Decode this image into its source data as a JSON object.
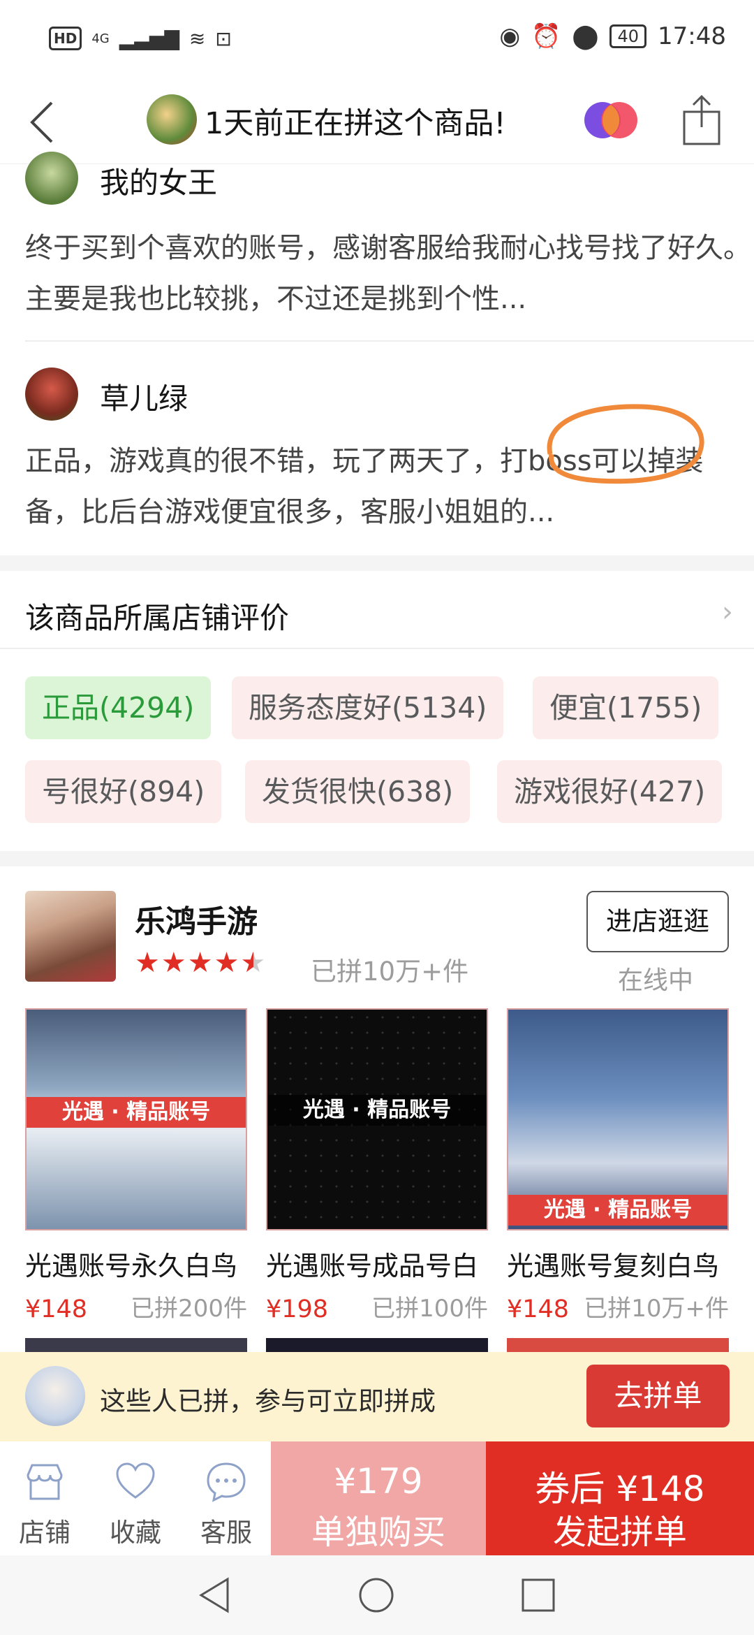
{
  "status_bar": {
    "network": "4G",
    "time": "17:48",
    "battery": "40"
  },
  "header": {
    "title": "1天前正在拼这个商品!"
  },
  "reviews": [
    {
      "name": "我的女王",
      "text": "终于买到个喜欢的账号，感谢客服给我耐心找号找了好久。主要是我也比较挑，不过还是挑到个性..."
    },
    {
      "name": "草儿绿",
      "text": "正品，游戏真的很不错，玩了两天了，打boss可以掉装备，比后台游戏便宜很多，客服小姐姐的...",
      "highlight": "打boss可"
    }
  ],
  "store_rating": {
    "title": "该商品所属店铺评价",
    "tags": [
      "正品(4294)",
      "服务态度好(5134)",
      "便宜(1755)",
      "号很好(894)",
      "发货很快(638)",
      "游戏很好(427)"
    ]
  },
  "shop": {
    "name": "乐鸿手游",
    "rating": 4.5,
    "sold": "已拼10万+件",
    "visit_label": "进店逛逛",
    "status": "在线中"
  },
  "products": [
    {
      "title": "光遇账号永久白鸟",
      "price": "¥148",
      "sold": "已拼200件",
      "badge": "光遇 · 精品账号"
    },
    {
      "title": "光遇账号成品号白",
      "price": "¥198",
      "sold": "已拼100件",
      "badge": "光遇 · 精品账号"
    },
    {
      "title": "光遇账号复刻白鸟",
      "price": "¥148",
      "sold": "已拼10万+件",
      "badge": "光遇 · 精品账号"
    }
  ],
  "join_banner": {
    "text": "这些人已拼，参与可立即拼成",
    "button": "去拼单"
  },
  "bottom_bar": {
    "store_label": "店铺",
    "favorite_label": "收藏",
    "service_label": "客服",
    "single_price": "¥179",
    "single_label": "单独购买",
    "group_price": "券后 ¥148",
    "group_label": "发起拼单"
  },
  "colors": {
    "brand_red": "#e02e24",
    "tag_bg": "#fcedec",
    "tag_green_bg": "#dcf5d6",
    "highlight_orange": "#f08a3a"
  }
}
